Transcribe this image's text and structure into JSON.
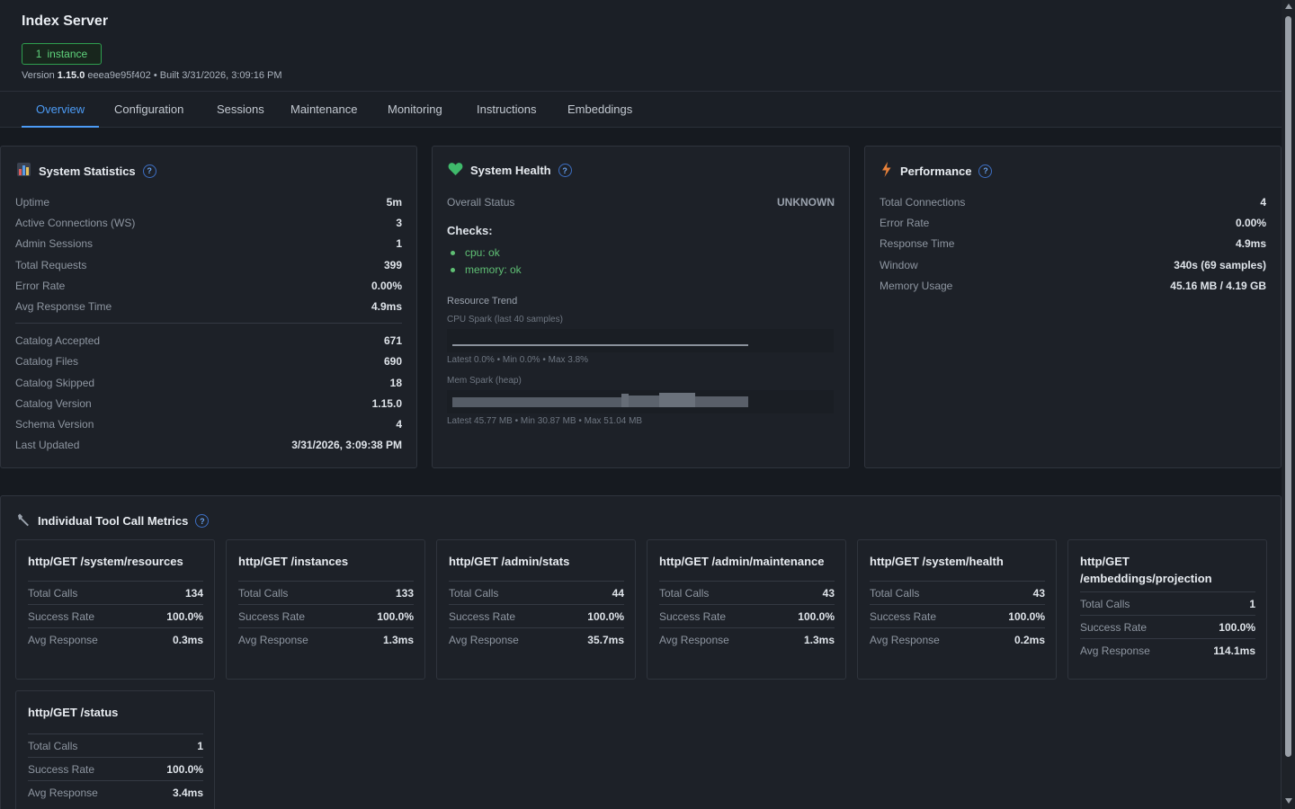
{
  "app": {
    "title": "Index Server",
    "instance_count": "1",
    "instance_label": "instance",
    "version_prefix": "Version",
    "version": "1.15.0",
    "version_suffix": "eeea9e95f402 • Built 3/31/2026, 3:09:16 PM"
  },
  "tabs": [
    "Overview",
    "Configuration",
    "Sessions",
    "Maintenance",
    "Monitoring",
    "Instructions",
    "Embeddings"
  ],
  "system_statistics": {
    "title": "System Statistics",
    "help": "?",
    "rows": [
      {
        "label": "Uptime",
        "value": "5m"
      },
      {
        "label": "Active Connections (WS)",
        "value": "3"
      },
      {
        "label": "Admin Sessions",
        "value": "1"
      },
      {
        "label": "Total Requests",
        "value": "399"
      },
      {
        "label": "Error Rate",
        "value": "0.00%"
      },
      {
        "label": "Avg Response Time",
        "value": "4.9ms"
      }
    ],
    "catalog_rows": [
      {
        "label": "Catalog Accepted",
        "value": "671"
      },
      {
        "label": "Catalog Files",
        "value": "690"
      },
      {
        "label": "Catalog Skipped",
        "value": "18"
      },
      {
        "label": "Catalog Version",
        "value": "1.15.0"
      },
      {
        "label": "Schema Version",
        "value": "4"
      },
      {
        "label": "Last Updated",
        "value": "3/31/2026, 3:09:38 PM"
      }
    ]
  },
  "system_health": {
    "title": "System Health",
    "help": "?",
    "overall_label": "Overall Status",
    "overall_value": "UNKNOWN",
    "checks_title": "Checks:",
    "checks": [
      "cpu: ok",
      "memory: ok"
    ],
    "resource_trend": "Resource Trend",
    "cpu_label": "CPU Spark (last 40 samples)",
    "cpu_stats": "Latest 0.0% • Min 0.0% • Max 3.8%",
    "mem_label": "Mem Spark (heap)",
    "mem_stats": "Latest 45.77 MB • Min 30.87 MB • Max 51.04 MB"
  },
  "performance": {
    "title": "Performance",
    "help": "?",
    "rows": [
      {
        "label": "Total Connections",
        "value": "4"
      },
      {
        "label": "Error Rate",
        "value": "0.00%"
      },
      {
        "label": "Response Time",
        "value": "4.9ms"
      },
      {
        "label": "Window",
        "value": "340s (69 samples)"
      },
      {
        "label": "Memory Usage",
        "value": "45.16 MB / 4.19 GB"
      }
    ]
  },
  "tool_metrics": {
    "title": "Individual Tool Call Metrics",
    "help": "?",
    "labels": {
      "calls": "Total Calls",
      "success": "Success Rate",
      "avg": "Avg Response"
    },
    "tools": [
      {
        "name": "http/GET /system/resources",
        "calls": "134",
        "success": "100.0%",
        "avg": "0.3ms"
      },
      {
        "name": "http/GET /instances",
        "calls": "133",
        "success": "100.0%",
        "avg": "1.3ms"
      },
      {
        "name": "http/GET /admin/stats",
        "calls": "44",
        "success": "100.0%",
        "avg": "35.7ms"
      },
      {
        "name": "http/GET /admin/maintenance",
        "calls": "43",
        "success": "100.0%",
        "avg": "1.3ms"
      },
      {
        "name": "http/GET /system/health",
        "calls": "43",
        "success": "100.0%",
        "avg": "0.2ms"
      },
      {
        "name": "http/GET /embeddings/projection",
        "calls": "1",
        "success": "100.0%",
        "avg": "114.1ms"
      },
      {
        "name": "http/GET /status",
        "calls": "1",
        "success": "100.0%",
        "avg": "3.4ms"
      }
    ]
  },
  "colors": {
    "accent": "#4c9bf5",
    "ok": "#5fbf74",
    "badge": "#2f9e4f"
  }
}
